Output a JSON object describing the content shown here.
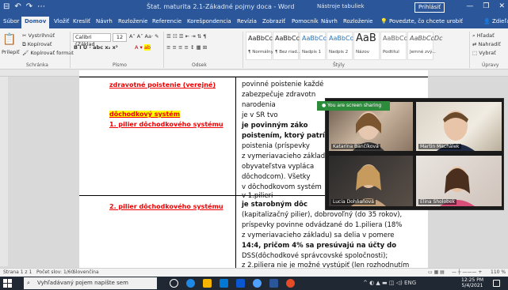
{
  "titlebar": {
    "quick_access": [
      "⊟",
      "↶",
      "↷",
      "⋯"
    ],
    "title": "Štat. maturita 2.1-Zákadné pojmy doca - Word",
    "context": "Nástroje tabuliek",
    "signin": "Prihlásiť",
    "window_controls": [
      "—",
      "❐",
      "✕"
    ]
  },
  "tabs": {
    "items": [
      "Súbor",
      "Domov",
      "Vložiť",
      "Kresliť",
      "Návrh",
      "Rozloženie",
      "Referencie",
      "Korešpondencia",
      "Revízia",
      "Zobraziť",
      "Pomocník",
      "Návrh",
      "Rozloženie"
    ],
    "active_index": 1,
    "tell_me": "Povedzte, čo chcete urobiť",
    "share": "Zdieľať"
  },
  "ribbon": {
    "clipboard": {
      "paste": "Prilepiť",
      "cut": "Vystrihnúť",
      "copy": "Kopírovať",
      "format_painter": "Kopírovať formát",
      "label": "Schránka"
    },
    "font": {
      "name": "Calibri (Základ",
      "size": "12",
      "label": "Písmo",
      "format_row": "B I U · abc x₂ x²"
    },
    "paragraph": {
      "label": "Odsek"
    },
    "styles": {
      "items": [
        {
          "sample": "AaBbCcDc",
          "name": "¶ Normálny"
        },
        {
          "sample": "AaBbCcDc",
          "name": "¶ Bez riad..."
        },
        {
          "sample": "AaBbCc",
          "name": "Nadpis 1"
        },
        {
          "sample": "AaBbCcE",
          "name": "Nadpis 2"
        },
        {
          "sample": "AaB",
          "name": "Názov"
        },
        {
          "sample": "AaBbCcD",
          "name": "Podtitul"
        },
        {
          "sample": "AaBbCcDc",
          "name": "Jemné zvý..."
        }
      ],
      "label": "Štýly"
    },
    "editing": {
      "find": "Hľadať",
      "replace": "Nahradiť",
      "select": "Vybrať",
      "label": "Úpravy"
    }
  },
  "document": {
    "left_headings": [
      "zdravotné poistenie (verejné)",
      "dôchodkový systém",
      "1. pilier dôchodkového systému",
      "2. pilier dôchodkového systému"
    ],
    "right_top": [
      "povinné poistenie každé",
      "zabezpečuje zdravotn",
      "narodenia",
      "je v SR tvo"
    ],
    "right_pillar1": [
      "je povinným záko",
      "poistením, ktorý patrí",
      "poistenia (príspevky",
      "z vymeriavacieho základ",
      "obyvateľstva vypláca",
      "dôchodcom). Všetky",
      "v dôchodkovom systém",
      "v 1.pilieri"
    ],
    "right_pillar2": [
      "je starobným dôc",
      "(kapitalizačný pilier), dobrovoľný (do 35 rokov),",
      "príspevky povinne odvádzané do 1.piliera (18%",
      "z vymeriavacieho základu) sa delia v pomere",
      "14:4, pričom 4% sa presúvajú na účty do",
      "DSS(dôchodkové správcovské spoločnosti);",
      "z 2.piliera nie je možné vystúpiť (len rozhodnutím"
    ]
  },
  "video_call": {
    "screen_share_label": "You are screen sharing",
    "participants": [
      "Katarína Bančíková",
      "Martin Machálek",
      "Lucia Dohňaňová",
      "Elina Sholobek"
    ]
  },
  "statusbar": {
    "page": "Strana 1 z 1",
    "words": "Počet slov: 1/60",
    "language": "Slovenčina",
    "zoom": "110 %"
  },
  "taskbar": {
    "search_placeholder": "Vyhľadávaný pojem napíšte sem",
    "time": "12:25 PM",
    "date": "5/4/2021",
    "tray": "^ ◐ ▲ ▬ ◫ ◁) ENG"
  },
  "colors": {
    "word_blue": "#2b579a",
    "heading_red": "#e00000",
    "highlight": "#ffff00",
    "share_green": "#2d8c3c"
  }
}
